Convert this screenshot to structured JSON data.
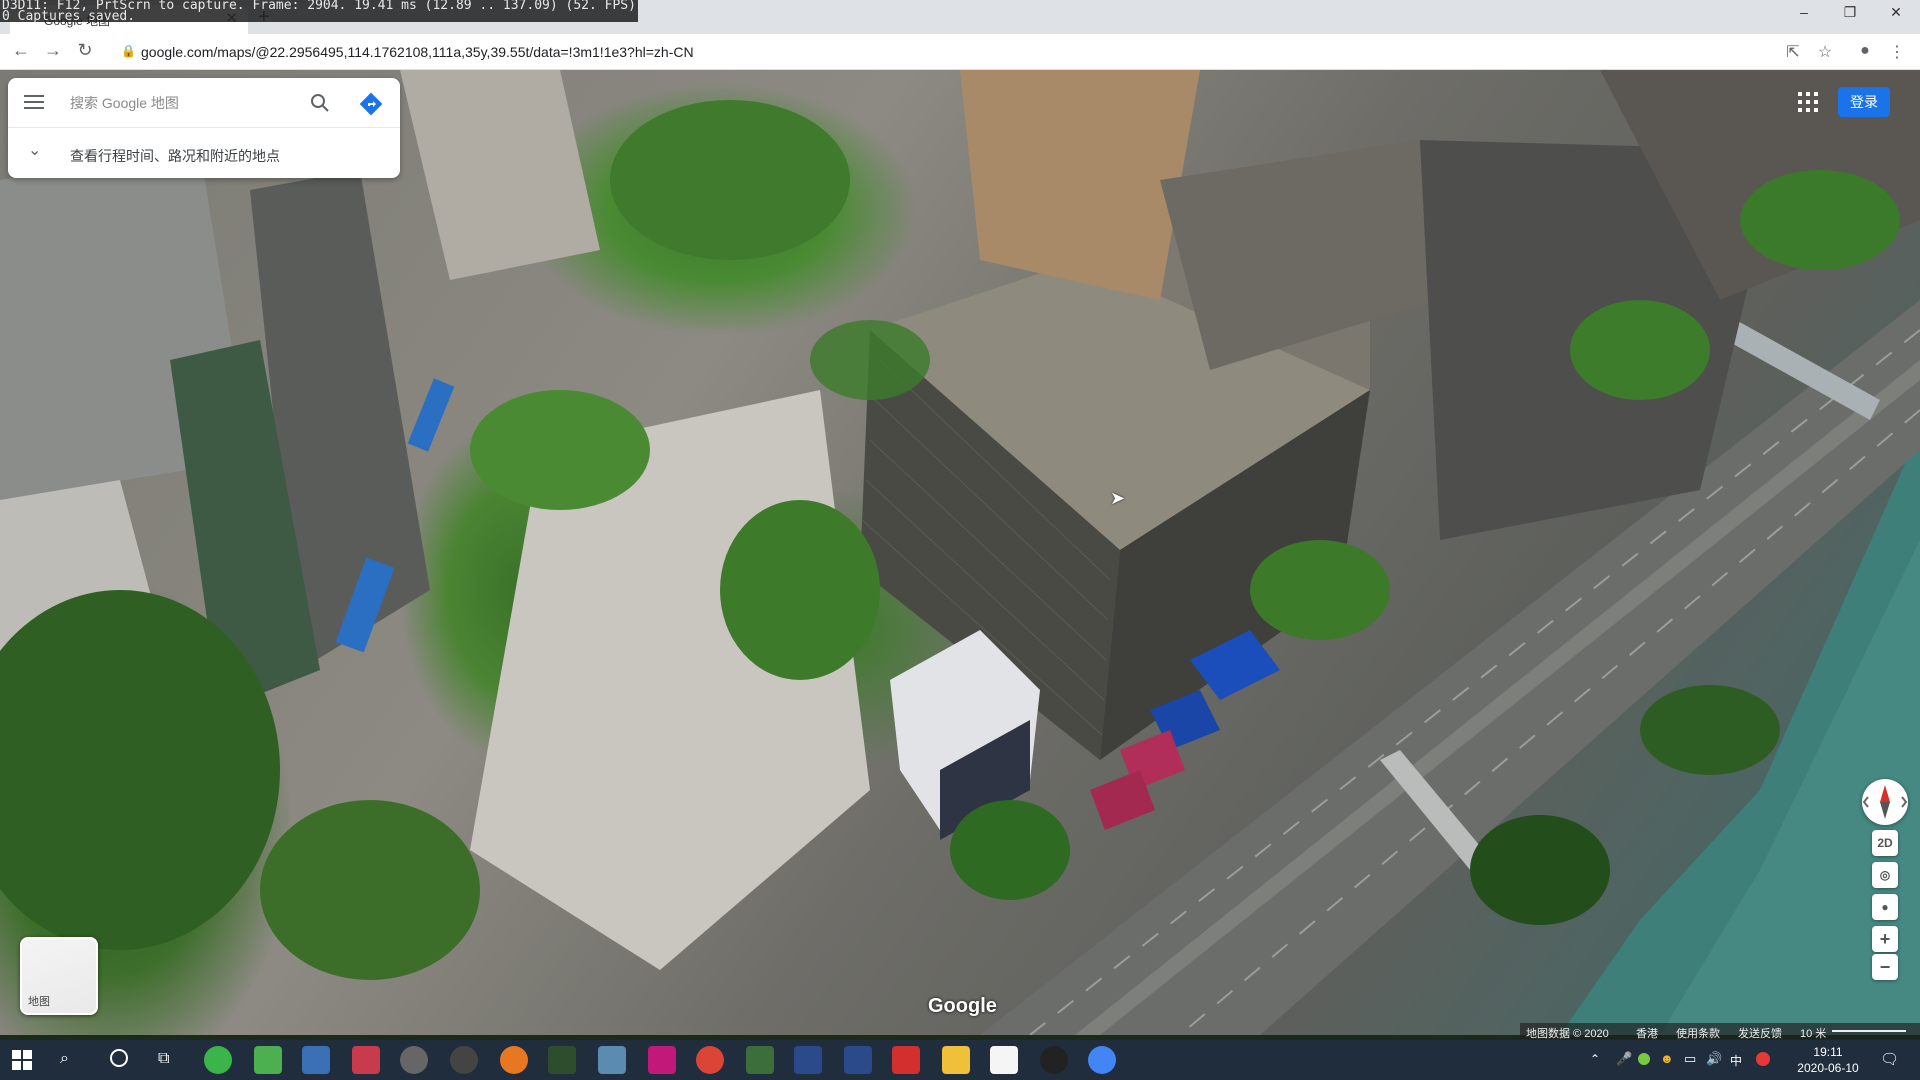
{
  "debug_overlay": {
    "line1": "D3D11: F12, PrtScrn to capture. Frame: 2904. 19.41 ms (12.89 .. 137.09) (52. FPS)",
    "line2": "0 Captures saved."
  },
  "browser": {
    "tab_title": "Google 地图",
    "url": "google.com/maps/@22.2956495,114.1762108,111a,35y,39.55t/data=!3m1!1e3?hl=zh-CN",
    "window_buttons": [
      "–",
      "❐",
      "✕"
    ]
  },
  "search": {
    "placeholder": "搜索 Google 地图",
    "travel_hint": "查看行程时间、路况和附近的地点"
  },
  "signin_label": "登录",
  "layer_thumb_label": "地图",
  "map_controls": {
    "mode_2d_label": "2D",
    "zoom_in": "+",
    "zoom_out": "−"
  },
  "logo_text": "Google",
  "attribution": {
    "map_data": "地图数据 © 2020",
    "region": "香港",
    "terms": "使用条款",
    "feedback": "发送反馈",
    "scale": "10 米"
  },
  "taskbar": {
    "time": "19:11",
    "date": "2020-06-10",
    "ime": "中"
  }
}
